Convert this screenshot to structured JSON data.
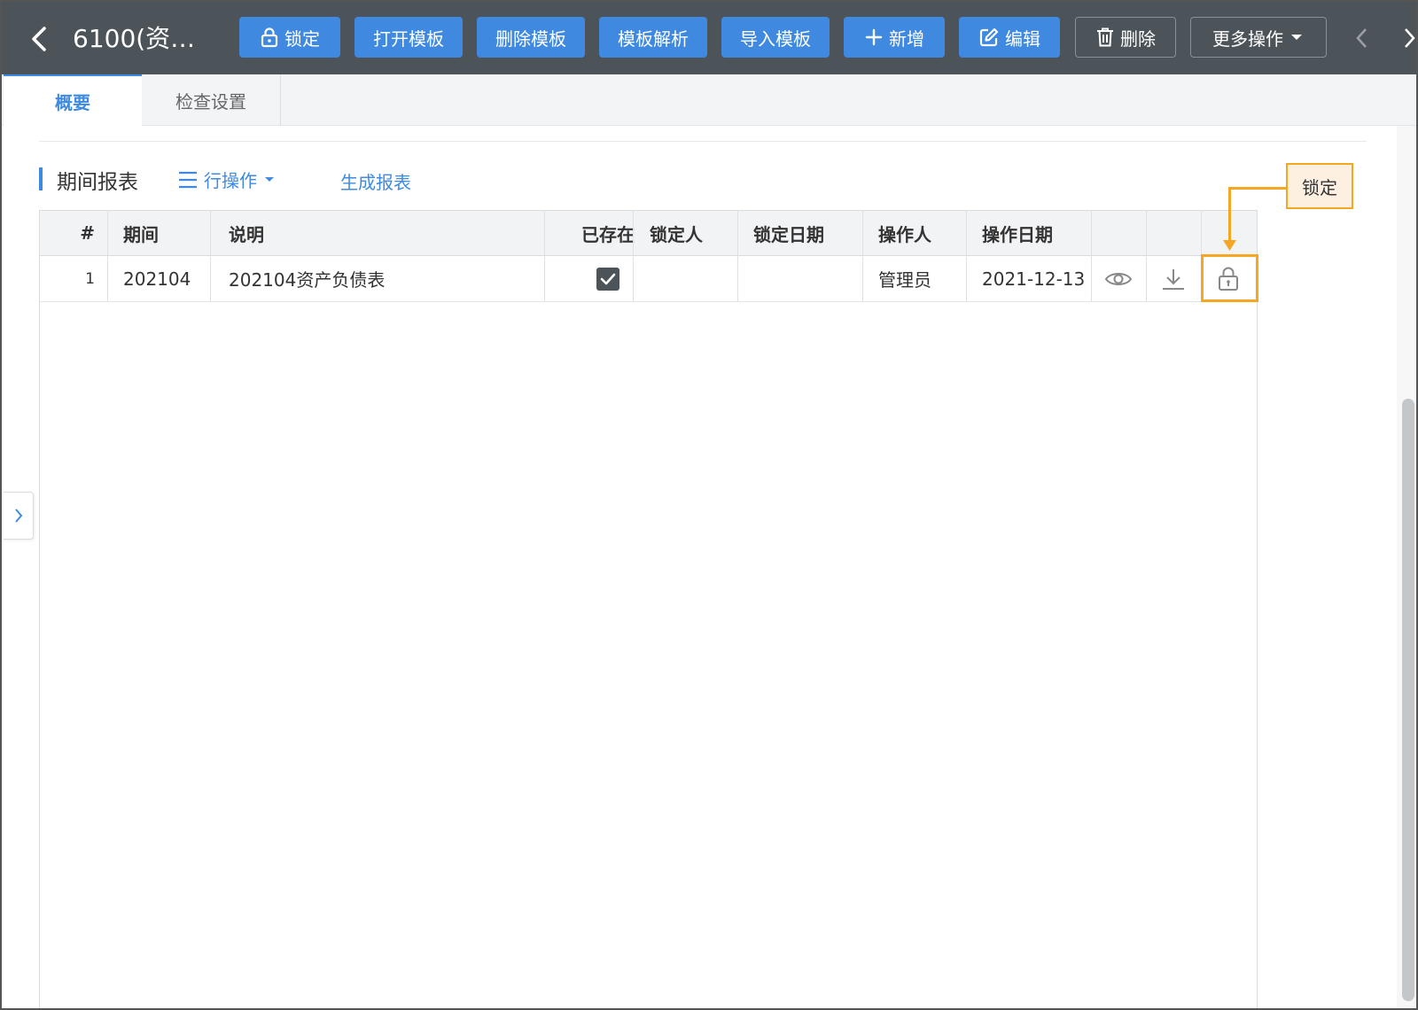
{
  "header": {
    "title": "6100(资…",
    "buttons": {
      "lock": "锁定",
      "open_template": "打开模板",
      "delete_template": "删除模板",
      "parse_template": "模板解析",
      "import_template": "导入模板",
      "add": "新增",
      "edit": "编辑",
      "delete": "删除",
      "more": "更多操作"
    }
  },
  "tabs": [
    {
      "label": "概要",
      "active": true
    },
    {
      "label": "检查设置",
      "active": false
    }
  ],
  "section": {
    "title": "期间报表",
    "row_ops": "行操作",
    "generate": "生成报表"
  },
  "table": {
    "columns": [
      "#",
      "期间",
      "说明",
      "已存在",
      "锁定人",
      "锁定日期",
      "操作人",
      "操作日期"
    ],
    "rows": [
      {
        "index": "1",
        "period": "202104",
        "desc": "202104资产负债表",
        "exists": true,
        "locker": "",
        "lock_date": "",
        "operator": "管理员",
        "op_date": "2021-12-13"
      }
    ]
  },
  "callout": {
    "label": "锁定"
  },
  "colors": {
    "accent": "#3f8ae0",
    "toolbar": "#4d5459",
    "highlight": "#f5a623"
  },
  "icons": [
    "back-icon",
    "lock-icon",
    "plus-icon",
    "edit-icon",
    "trash-icon",
    "caret-down-icon",
    "chevron-left-icon",
    "chevron-right-icon",
    "list-icon",
    "checkbox-checked-icon",
    "eye-icon",
    "download-icon",
    "unlock-icon"
  ]
}
